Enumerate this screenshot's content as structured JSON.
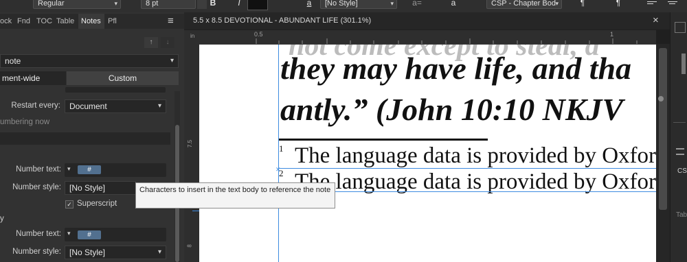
{
  "toolbar": {
    "font_style": "Regular",
    "font_size": "8 pt",
    "char_style": "[No Style]",
    "para_style": "CSP - Chapter Bod",
    "bold_label": "B",
    "italic_label": "I",
    "icon_glyph_a_underline": "a",
    "icon_glyph_ae": "a=",
    "icon_glyph_a": "a",
    "para_glyph": "¶",
    "para_glyph2": "¶"
  },
  "panel": {
    "tabs": [
      "ock",
      "Fnd",
      "TOC",
      "Table",
      "Notes",
      "Pfl"
    ],
    "active_tab": "Notes",
    "menu_glyph": "≡",
    "note_type": "note",
    "scope_tabs": [
      "ment-wide",
      "Custom"
    ],
    "restart_label": "Restart every:",
    "restart_value": "Document",
    "numbering_now": "umbering now",
    "number_text_label_1": "Number text:",
    "number_text_value_1": "#",
    "number_style_label_1": "Number style:",
    "number_style_value_1": "[No Style]",
    "superscript_label": "Superscript",
    "section_y": "y",
    "number_text_label_2": "Number text:",
    "number_text_value_2": "#",
    "number_style_label_2": "Number style:",
    "number_style_value_2": "[No Style]"
  },
  "tooltip": {
    "text": "Characters to insert in the text body to reference the note"
  },
  "document": {
    "title": "5.5 x 8.5 DEVOTIONAL - ABUNDANT LIFE (301.1%)",
    "close_glyph": "×",
    "ruler_unit": "in",
    "ruler_top_labels": [
      "0.5",
      "1"
    ],
    "ruler_left_labels": [
      "7.5",
      "8"
    ],
    "line0": "not come except to steal, a",
    "line1": "they may have life, and tha",
    "line2": "antly.” (John 10:10 NKJV",
    "footnote_number_1": "1",
    "footnote_1": "The language data is provided by Oxford",
    "footnote_number_2": "2",
    "footnote_2": "The language data is provided by Oxford"
  },
  "rightbar": {
    "label_cs": "CS",
    "label_tab": "Tab"
  }
}
